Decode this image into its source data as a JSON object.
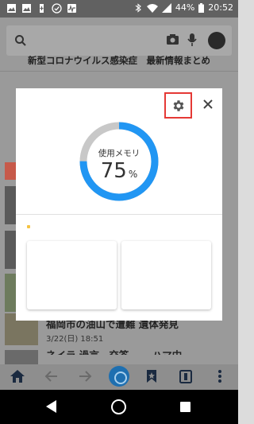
{
  "status_bar": {
    "battery": "44%",
    "time": "20:52"
  },
  "background": {
    "headline": "新型コロナウイルス感染症　最新情報まとめ",
    "story_title": "福岡市の油山で遭難 遺体発見",
    "story_date": "3/22(日) 18:51",
    "story2_title": "ネイラ 過言　交答 ――ハマ中"
  },
  "memory_dialog": {
    "label": "使用メモリ",
    "value": "75",
    "unit": "%",
    "usage_fraction": 0.75,
    "colors": {
      "ring": "#2196f3",
      "ring_track": "#c8c8c8",
      "highlight": "#e53935"
    }
  }
}
